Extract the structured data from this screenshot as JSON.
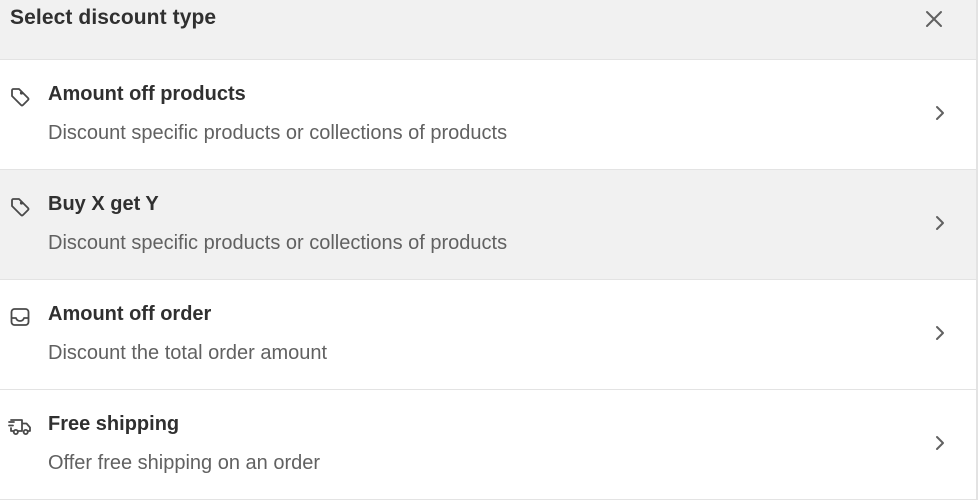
{
  "dialog": {
    "title": "Select discount type",
    "close_icon": "close-icon"
  },
  "items": [
    {
      "title": "Amount off products",
      "description": "Discount specific products or collections of products",
      "icon": "tag-icon",
      "state": "default"
    },
    {
      "title": "Buy X get Y",
      "description": "Discount specific products or collections of products",
      "icon": "tag-icon",
      "state": "hover"
    },
    {
      "title": "Amount off order",
      "description": "Discount the total order amount",
      "icon": "inbox-icon",
      "state": "default"
    },
    {
      "title": "Free shipping",
      "description": "Offer free shipping on an order",
      "icon": "delivery-truck-icon",
      "state": "default"
    }
  ],
  "colors": {
    "header_bg": "#f1f1f1",
    "hover_bg": "#f1f1f1",
    "title_text": "#303030",
    "description_text": "#616161",
    "divider": "#e3e3e3"
  }
}
